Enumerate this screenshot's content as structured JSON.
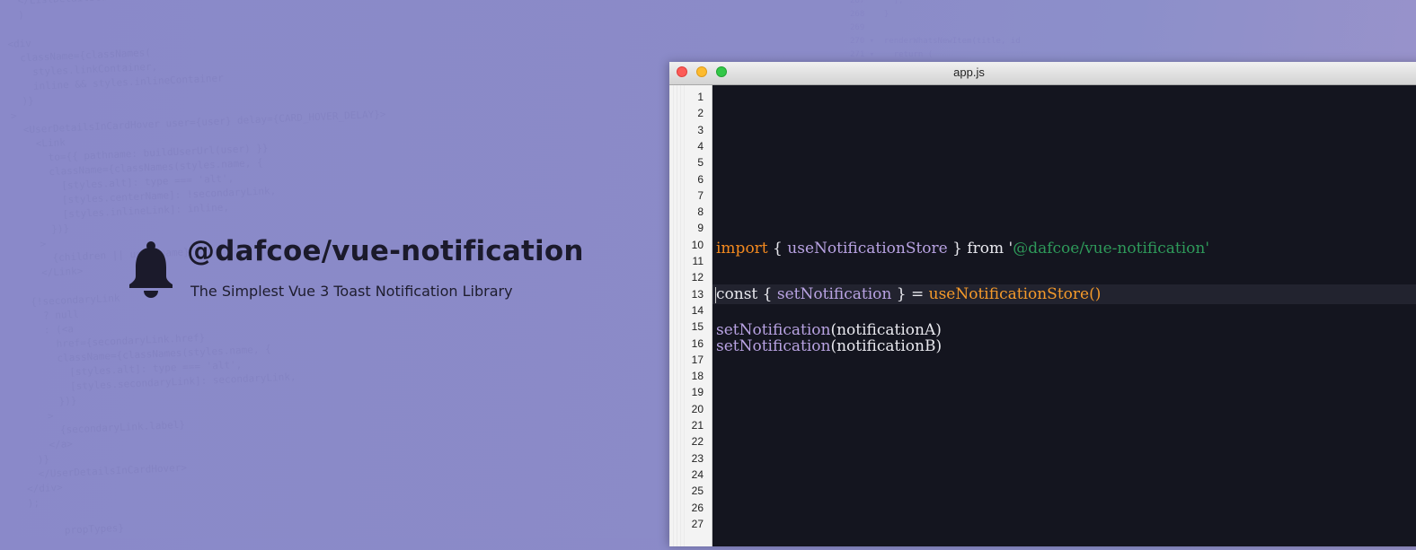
{
  "hero": {
    "title": "@dafcoe/vue-notification",
    "subtitle": "The Simplest Vue 3 Toast Notification Library",
    "icon": "bell-icon"
  },
  "editor": {
    "window_title": "app.js",
    "line_numbers": [
      "1",
      "2",
      "3",
      "4",
      "5",
      "6",
      "7",
      "8",
      "9",
      "10",
      "11",
      "12",
      "13",
      "14",
      "15",
      "16",
      "17",
      "18",
      "19",
      "20",
      "21",
      "22",
      "23",
      "24",
      "25",
      "26",
      "27"
    ],
    "line10": {
      "kw": "import",
      "brace_open": " { ",
      "fn": "useNotificationStore",
      "brace_close": " } ",
      "from": "from '",
      "str": "@dafcoe/vue-notification",
      "quote": "'"
    },
    "line13": {
      "kw": "const",
      "brace_open": " { ",
      "fn": "setNotification",
      "rest": " } = ",
      "call": "useNotificationStore()"
    },
    "line15": {
      "fn": "setNotification",
      "args": "(notificationA)"
    },
    "line16": {
      "fn": "setNotification",
      "args": "(notificationB)"
    }
  },
  "background": {
    "code_left": "  </ListDetailsCardHeader>\n  )\n\n<div\n  className={classNames(\n    styles.linkContainer,\n    inline && styles.inlineContainer\n  )}\n>\n  <UserDetailsInCardHover user={user} delay={CARD_HOVER_DELAY}>\n    <Link\n      to={{ pathname: buildUserUrl(user) }}\n      className={classNames(styles.name, {\n        [styles.alt]: type === 'alt',\n        [styles.centerName]: !secondaryLink,\n        [styles.inlineLink]: inline,\n      })}\n    >\n      {children || user.name}\n    </Link>\n\n  {!secondaryLink\n    ? null\n    : (<a\n      href={secondaryLink.href}\n      className={classNames(styles.name, {\n        [styles.alt]: type === 'alt',\n        [styles.secondaryLink]: secondaryLink,\n      })}\n    >\n      {secondaryLink.label}\n    </a>\n  )}\n  </UserDetailsInCardHover>\n</div>\n);\n\n      propTypes}",
    "code_right": "267      ];\n268    }\n269\n270 ▾  renderWhatsNewItem(title, id\n271 ▾    return (\n          "
  },
  "colors": {
    "keyword": "#f58a1f",
    "identifier": "#b9a3e3",
    "string": "#2e9a5a",
    "call": "#f59a2a",
    "editor_bg": "#14151f",
    "page_bg": "#8a89c9"
  }
}
